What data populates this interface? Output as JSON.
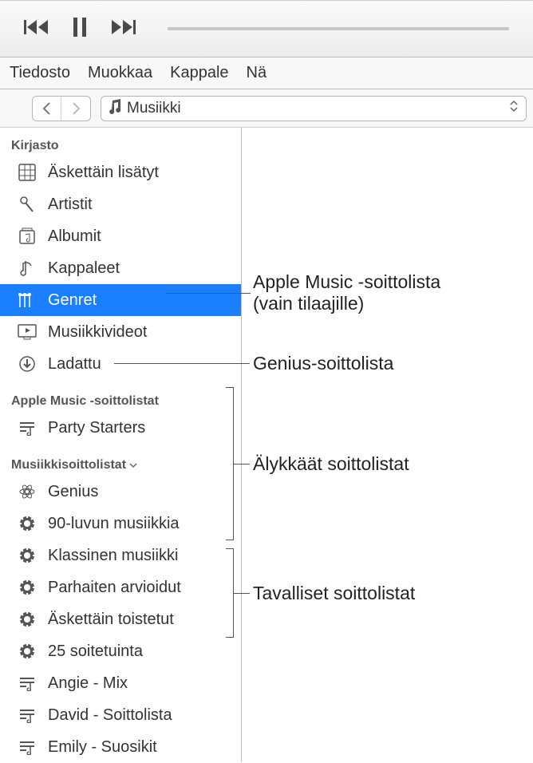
{
  "menubar": {
    "file": "Tiedosto",
    "edit": "Muokkaa",
    "song": "Kappale",
    "view": "Nä"
  },
  "library_selector": "Musiikki",
  "sections": {
    "library": {
      "title": "Kirjasto",
      "items": [
        {
          "label": "Äskettäin lisätyt",
          "icon": "grid-icon"
        },
        {
          "label": "Artistit",
          "icon": "microphone-icon"
        },
        {
          "label": "Albumit",
          "icon": "album-icon"
        },
        {
          "label": "Kappaleet",
          "icon": "note-icon"
        },
        {
          "label": "Genret",
          "icon": "guitar-icon",
          "selected": true
        },
        {
          "label": "Musiikkivideot",
          "icon": "video-icon"
        },
        {
          "label": "Ladattu",
          "icon": "download-icon"
        }
      ]
    },
    "apple_music_playlists": {
      "title": "Apple Music -soittolistat",
      "items": [
        {
          "label": "Party Starters",
          "icon": "playlist-icon"
        }
      ]
    },
    "music_playlists": {
      "title": "Musiikkisoittolistat",
      "items": [
        {
          "label": "Genius",
          "icon": "genius-icon"
        },
        {
          "label": "90-luvun musiikkia",
          "icon": "smart-icon"
        },
        {
          "label": "Klassinen musiikki",
          "icon": "smart-icon"
        },
        {
          "label": "Parhaiten arvioidut",
          "icon": "smart-icon"
        },
        {
          "label": "Äskettäin toistetut",
          "icon": "smart-icon"
        },
        {
          "label": "25 soitetuinta",
          "icon": "smart-icon"
        },
        {
          "label": "Angie - Mix",
          "icon": "playlist-icon"
        },
        {
          "label": "David - Soittolista",
          "icon": "playlist-icon"
        },
        {
          "label": "Emily - Suosikit",
          "icon": "playlist-icon"
        }
      ]
    }
  },
  "callouts": {
    "apple_music": {
      "line1": "Apple Music -soittolista",
      "line2": "(vain tilaajille)"
    },
    "genius": "Genius-soittolista",
    "smart": "Älykkäät soittolistat",
    "regular": "Tavalliset soittolistat"
  }
}
